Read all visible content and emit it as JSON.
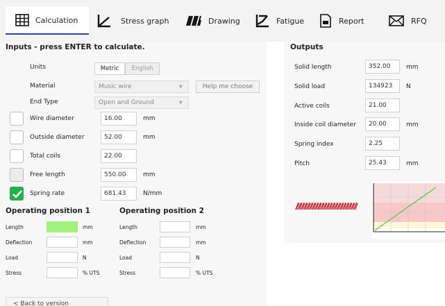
{
  "tabs": [
    {
      "label": "Calculation",
      "icon": "grid-icon",
      "active": true
    },
    {
      "label": "Stress graph",
      "icon": "graph-icon",
      "active": false
    },
    {
      "label": "Drawing",
      "icon": "spring-coil-icon",
      "active": false
    },
    {
      "label": "Fatigue",
      "icon": "fatigue-icon",
      "active": false
    },
    {
      "label": "Report",
      "icon": "report-icon",
      "active": false
    },
    {
      "label": "RFQ",
      "icon": "envelope-icon",
      "active": false
    }
  ],
  "inputs": {
    "title": "Inputs - press ENTER to calculate.",
    "units_label": "Units",
    "units_metric": "Metric",
    "units_english": "English",
    "material_label": "Material",
    "material_value": "Music wire",
    "help_button": "Help me choose",
    "end_type_label": "End Type",
    "end_type_value": "Open and Ground",
    "rows": [
      {
        "label": "Wire diameter",
        "value": "16.00",
        "unit": "mm",
        "checked": false
      },
      {
        "label": "Outside diameter",
        "value": "52.00",
        "unit": "mm",
        "checked": false
      },
      {
        "label": "Total coils",
        "value": "22.00",
        "unit": "",
        "checked": false
      },
      {
        "label": "Free length",
        "value": "550.00",
        "unit": "mm",
        "checked": false
      },
      {
        "label": "Spring rate",
        "value": "681.43",
        "unit": "N/mm",
        "checked": true
      }
    ]
  },
  "outputs": {
    "title": "Outputs",
    "rows": [
      {
        "label": "Solid length",
        "value": "352.00",
        "unit": "mm"
      },
      {
        "label": "Solid load",
        "value": "134923",
        "unit": "N"
      },
      {
        "label": "Active coils",
        "value": "21.00",
        "unit": ""
      },
      {
        "label": "Inside coil diameter",
        "value": "20.00",
        "unit": "mm"
      },
      {
        "label": "Spring index",
        "value": "2.25",
        "unit": ""
      },
      {
        "label": "Pitch",
        "value": "25.43",
        "unit": "mm"
      }
    ]
  },
  "operating": [
    {
      "title": "Operating position 1",
      "rows": [
        {
          "label": "Length",
          "value": "",
          "unit": "mm",
          "highlight": true
        },
        {
          "label": "Deflection",
          "value": "",
          "unit": "mm",
          "highlight": false
        },
        {
          "label": "Load",
          "value": "",
          "unit": "N",
          "highlight": false
        },
        {
          "label": "Stress",
          "value": "",
          "unit": "% UTS",
          "highlight": false
        }
      ]
    },
    {
      "title": "Operating position 2",
      "rows": [
        {
          "label": "Length",
          "value": "",
          "unit": "mm",
          "highlight": false
        },
        {
          "label": "Deflection",
          "value": "",
          "unit": "mm",
          "highlight": false
        },
        {
          "label": "Load",
          "value": "",
          "unit": "N",
          "highlight": false
        },
        {
          "label": "Stress",
          "value": "",
          "unit": "% UTS",
          "highlight": false
        }
      ]
    }
  ],
  "back_button": "< Back to version",
  "colors": {
    "accent": "#2d3f8f",
    "checked_green": "#22b04b",
    "highlight_green": "#a4f07f",
    "spring_red": "#c8202a",
    "graph_line": "#3fce3f",
    "graph_zone_top": "#f6dada",
    "graph_zone_mid": "#f8c8c8"
  }
}
